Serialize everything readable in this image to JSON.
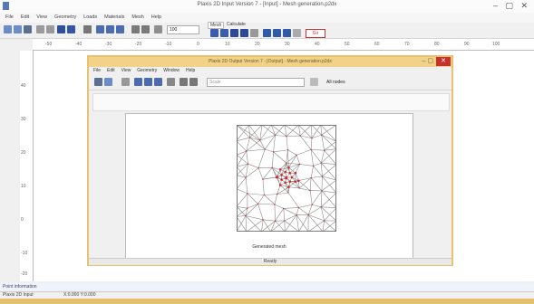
{
  "main_window": {
    "title": "Plaxis 2D Input Version 7 - [Input] - Mesh generation.p2dx",
    "controls": "– ▢ ✕"
  },
  "menubar": [
    "File",
    "Edit",
    "View",
    "Geometry",
    "Loads",
    "Materials",
    "Mesh",
    "Help"
  ],
  "toolbar": {
    "tabs": [
      "Mesh",
      "Calculate"
    ],
    "zoom_value": "100",
    "go_label": "Go"
  },
  "ruler_top": [
    "-50",
    "-40",
    "-30",
    "-20",
    "-10",
    "0",
    "10",
    "20",
    "30",
    "40",
    "50",
    "60",
    "70",
    "80",
    "90",
    "100"
  ],
  "ruler_left": [
    "40",
    "30",
    "20",
    "10",
    "0",
    "-10",
    "-20"
  ],
  "status": {
    "hint": "Point information",
    "left": "Plaxis 2D Input",
    "coords": "X:0.000  Y:0.000"
  },
  "dialog": {
    "title": "Plaxis 2D Output Version 7 - [Output] - Mesh generation.p2dx",
    "close": "✕",
    "minmax": "–  ▢",
    "menubar": [
      "File",
      "Edit",
      "View",
      "Geometry",
      "Window",
      "Help"
    ],
    "scale_placeholder": "Scale",
    "phase_label": "All nodes",
    "caption": "Generated mesh",
    "status": "Ready"
  },
  "colors": {
    "dialog_frame": "#e8c270",
    "mesh_line": "#8a8a8a",
    "mesh_node": "#d4282a",
    "close_red": "#c9302c"
  }
}
